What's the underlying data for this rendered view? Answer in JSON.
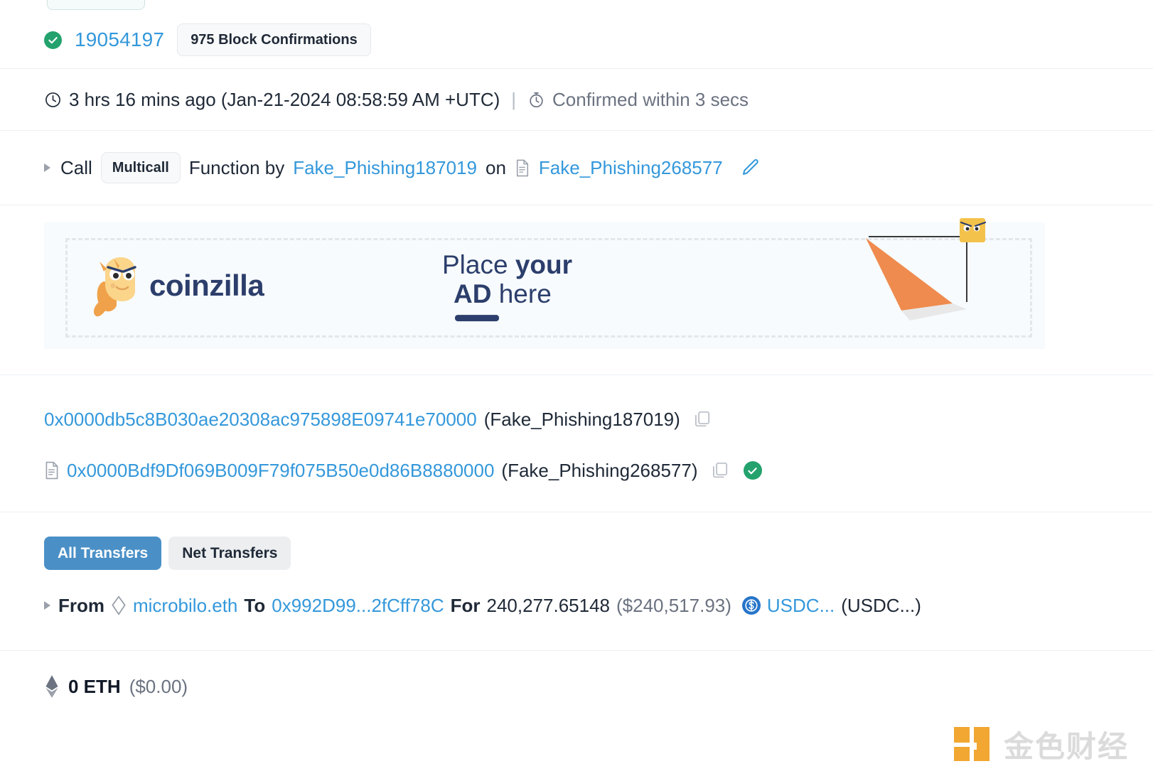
{
  "block": {
    "status_icon": "check-circle-icon",
    "number": "19054197",
    "confirmations": "975 Block Confirmations"
  },
  "timestamp": {
    "clock_icon": "clock-icon",
    "age": "3 hrs 16 mins ago (Jan-21-2024 08:58:59 AM +UTC)",
    "separator": "|",
    "stopwatch_icon": "stopwatch-icon",
    "confirmed_within": "Confirmed within 3 secs"
  },
  "call": {
    "caret_icon": "caret-right-icon",
    "prefix": "Call",
    "function_name": "Multicall",
    "middle": "Function by",
    "caller": "Fake_Phishing187019",
    "on": "on",
    "contract_icon": "contract-file-icon",
    "contract": "Fake_Phishing268577",
    "edit_icon": "pencil-edit-icon"
  },
  "ad": {
    "brand": "coinzilla",
    "line1_plain": "Place ",
    "line1_bold": "your",
    "line2_bold": "AD",
    "line2_plain": " here",
    "mascot_icon": "coinzilla-dragon-icon",
    "art_icon": "paper-plane-art-icon"
  },
  "addresses": [
    {
      "leading_icon": "",
      "address": "0x0000db5c8B030ae20308ac975898E09741e70000",
      "tag": "(Fake_Phishing187019)",
      "copy_icon": "copy-icon",
      "verified": false
    },
    {
      "leading_icon": "contract-file-icon",
      "address": "0x0000Bdf9Df069B009F79f075B50e0d86B8880000",
      "tag": "(Fake_Phishing268577)",
      "copy_icon": "copy-icon",
      "verified": true
    }
  ],
  "transfers": {
    "tabs": [
      {
        "label": "All Transfers",
        "active": true
      },
      {
        "label": "Net Transfers",
        "active": false
      }
    ],
    "row": {
      "caret_icon": "caret-right-icon",
      "from_label": "From",
      "from_icon": "ens-diamond-icon",
      "from_value": "microbilo.eth",
      "to_label": "To",
      "to_value": "0x992D99...2fCff78C",
      "for_label": "For",
      "amount": "240,277.65148",
      "fiat": "($240,517.93)",
      "token_icon": "usdc-token-icon",
      "token_symbol": "USDC...",
      "token_name": "(USDC...)"
    }
  },
  "value": {
    "eth_icon": "ethereum-diamond-icon",
    "amount": "0 ETH",
    "fiat": "($0.00)"
  },
  "watermark": {
    "text": "金色财经",
    "logo_icon": "jinse-logo-icon"
  },
  "colors": {
    "link": "#3498db",
    "success": "#23a26d",
    "tab_active": "#4a90c7",
    "usdc": "#2775ca",
    "ad_navy": "#2c3e6b",
    "ad_orange": "#ef8b4e"
  }
}
